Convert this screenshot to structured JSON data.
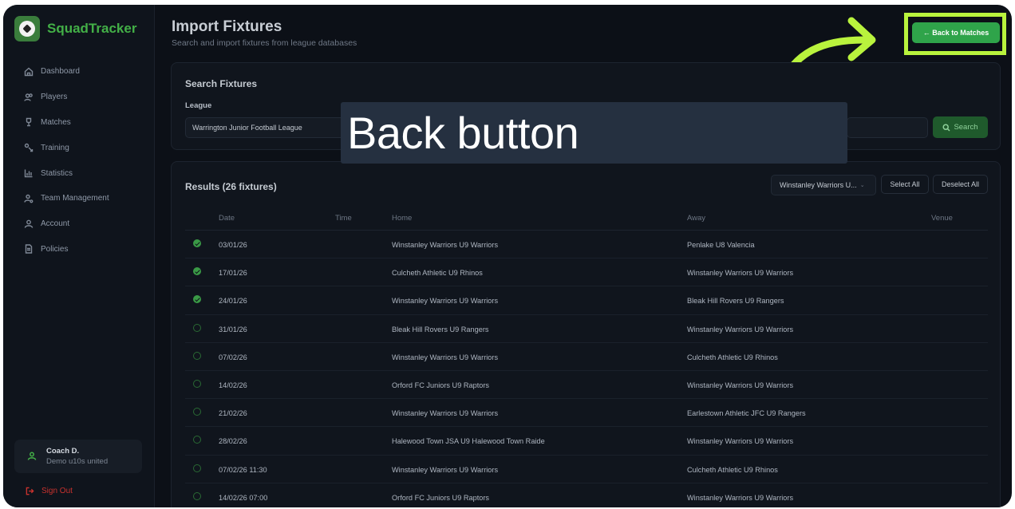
{
  "brand": {
    "name": "SquadTracker"
  },
  "nav": [
    {
      "label": "Dashboard",
      "icon": "home-icon"
    },
    {
      "label": "Players",
      "icon": "users-icon"
    },
    {
      "label": "Matches",
      "icon": "trophy-icon"
    },
    {
      "label": "Training",
      "icon": "training-icon"
    },
    {
      "label": "Statistics",
      "icon": "chart-icon"
    },
    {
      "label": "Team Management",
      "icon": "user-cog-icon"
    },
    {
      "label": "Account",
      "icon": "user-icon"
    },
    {
      "label": "Policies",
      "icon": "document-icon"
    }
  ],
  "user": {
    "name": "Coach D.",
    "team": "Demo u10s united"
  },
  "signout": "Sign Out",
  "page": {
    "title": "Import Fixtures",
    "subtitle": "Search and import fixtures from league databases"
  },
  "back_button": "← Back to Matches",
  "search": {
    "title": "Search Fixtures",
    "league_label": "League",
    "league_value": "Warrington Junior Football League",
    "button": "Search"
  },
  "overlay_text": "Back button",
  "results": {
    "title": "Results (26 fixtures)",
    "team_filter": "Winstanley Warriors U...",
    "select_all": "Select All",
    "deselect_all": "Deselect All",
    "columns": {
      "date": "Date",
      "time": "Time",
      "home": "Home",
      "away": "Away",
      "venue": "Venue"
    },
    "rows": [
      {
        "selected": true,
        "date": "03/01/26",
        "home": "Winstanley Warriors U9 Warriors",
        "away": "Penlake U8 Valencia"
      },
      {
        "selected": true,
        "date": "17/01/26",
        "home": "Culcheth Athletic U9 Rhinos",
        "away": "Winstanley Warriors U9 Warriors"
      },
      {
        "selected": true,
        "date": "24/01/26",
        "home": "Winstanley Warriors U9 Warriors",
        "away": "Bleak Hill Rovers U9 Rangers"
      },
      {
        "selected": false,
        "date": "31/01/26",
        "home": "Bleak Hill Rovers U9 Rangers",
        "away": "Winstanley Warriors U9 Warriors"
      },
      {
        "selected": false,
        "date": "07/02/26",
        "home": "Winstanley Warriors U9 Warriors",
        "away": "Culcheth Athletic U9 Rhinos"
      },
      {
        "selected": false,
        "date": "14/02/26",
        "home": "Orford FC Juniors U9 Raptors",
        "away": "Winstanley Warriors U9 Warriors"
      },
      {
        "selected": false,
        "date": "21/02/26",
        "home": "Winstanley Warriors U9 Warriors",
        "away": "Earlestown Athletic JFC U9 Rangers"
      },
      {
        "selected": false,
        "date": "28/02/26",
        "home": "Halewood Town JSA U9 Halewood Town Raide",
        "away": "Winstanley Warriors U9 Warriors"
      },
      {
        "selected": false,
        "date": "07/02/26 11:30",
        "home": "Winstanley Warriors U9 Warriors",
        "away": "Culcheth Athletic U9 Rhinos"
      },
      {
        "selected": false,
        "date": "14/02/26 07:00",
        "home": "Orford FC Juniors U9 Raptors",
        "away": "Winstanley Warriors U9 Warriors"
      }
    ]
  },
  "colors": {
    "accent": "#2fa44a",
    "highlight": "#b9f33d",
    "background": "#0c1017"
  }
}
